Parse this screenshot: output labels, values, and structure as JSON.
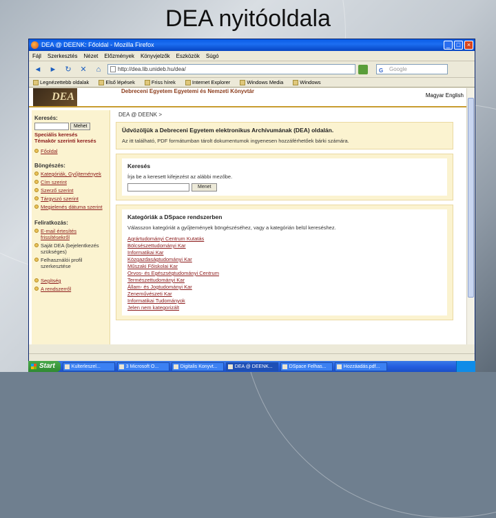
{
  "slide": {
    "title": "DEA nyitóoldala"
  },
  "window": {
    "title": "DEA @ DEENK: Főoldal - Mozilla Firefox",
    "buttons": {
      "minimize": "_",
      "maximize": "□",
      "close": "×"
    }
  },
  "menu": {
    "items": [
      "Fájl",
      "Szerkesztés",
      "Nézet",
      "Előzmények",
      "Könyvjelzők",
      "Eszközök",
      "Súgó"
    ]
  },
  "nav": {
    "back": "◄",
    "forward": "►",
    "reload": "↻",
    "stop": "✕",
    "home": "⌂",
    "url": "http://dea.lib.unideb.hu/dea/",
    "search_placeholder": "Google"
  },
  "bookmarks": {
    "items": [
      "Legnézettebb oldalak",
      "Első lépések",
      "Friss hírek",
      "Internet Explorer",
      "Windows Media",
      "Windows"
    ]
  },
  "site": {
    "logo_text": "DEA",
    "name": "Debreceni Egyetem Egyetemi és Nemzeti Könyvtár",
    "lang_switch": "Magyar  English"
  },
  "sidebar": {
    "search_heading": "Keresés:",
    "search_button": "Mehet",
    "advanced_search": "Speciális keresés",
    "subject_search": "Témakör szerinti keresés",
    "home_link": "Főoldal",
    "browse_heading": "Böngészés:",
    "browse_items": [
      "Kategóriák, Gyűjtemények",
      "Cím szerint",
      "Szerző szerint",
      "Tárgyszó szerint",
      "Megjelenés dátuma szerint"
    ],
    "subscribe_heading": "Feliratkozás:",
    "subscribe_items": [
      "E-mail értesítés frissítésekről",
      "Saját DEA (bejelentkezés szükséges)",
      "Felhasználói profil szerkesztése"
    ],
    "help_link": "Segítség",
    "about_link": "A rendszerről"
  },
  "main": {
    "breadcrumb": "DEA @ DEENK >",
    "welcome_title": "Üdvözöljük a Debreceni Egyetem elektronikus Archívumának (DEA) oldalán.",
    "welcome_text": "Az itt található, PDF formátumban tárolt dokumentumok ingyenesen hozzáférhetőek bárki számára.",
    "search_title": "Keresés",
    "search_text": "Írja be a keresett kifejezést az alábbi mezőbe.",
    "search_button": "Menet",
    "categories_title": "Kategóriák a DSpace rendszerben",
    "categories_text": "Válasszon kategóriát a gyűjtemények böngészéséhez, vagy a kategórián belül kereséshez.",
    "categories": [
      "Agrártudományi Centrum Kutatás",
      "Bölcsészettudományi Kar",
      "Informatikai Kar",
      "Közgazdaságtudományi Kar",
      "Műszaki Főiskolai Kar",
      "Orvos- és Egészségtudományi Centrum",
      "Természettudományi Kar",
      "Állam- és Jogtudományi Kar",
      "Zeneművészeti Kar",
      "Informatikai Tudományok",
      "Jelen nem kategorizált"
    ]
  },
  "taskbar": {
    "start": "Start",
    "tasks": [
      "Kulterleszel...",
      "3 Microsoft O...",
      "Digitalis Konyvt...",
      "DEA @ DEENK...",
      "DSpace Felhas...",
      "Hozzáadás.pdf..."
    ]
  }
}
